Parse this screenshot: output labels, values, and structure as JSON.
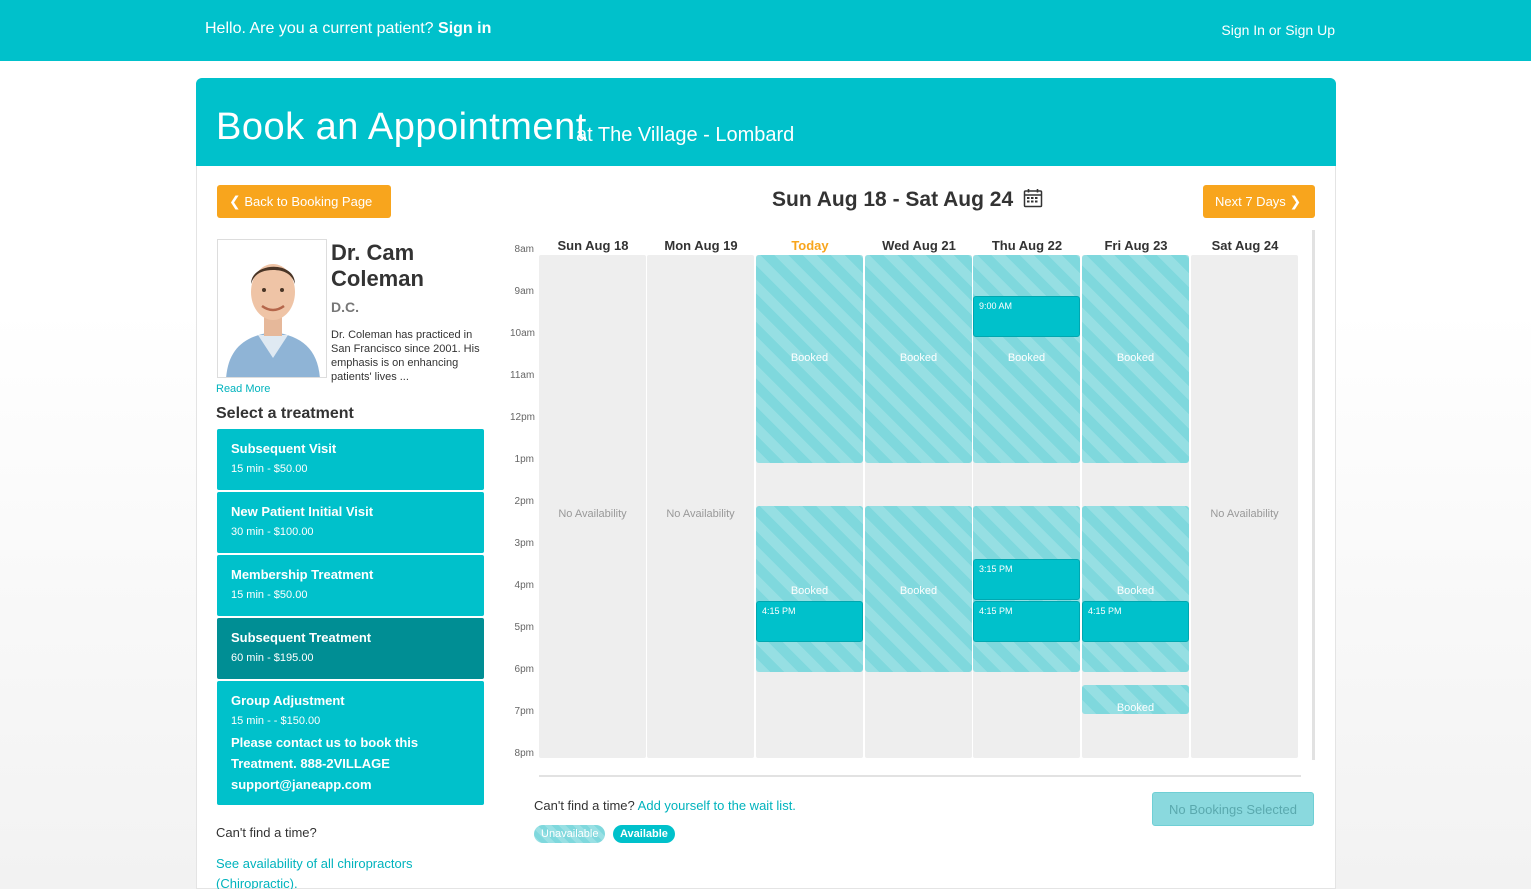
{
  "topbar": {
    "greeting": "Hello. Are you a current patient?",
    "sign_in": "Sign in",
    "sign_in_up": "Sign In or Sign Up"
  },
  "header": {
    "title": "Book an Appointment",
    "location": "at The Village - Lombard"
  },
  "nav": {
    "back_label": "Back to Booking Page",
    "next_label": "Next 7 Days",
    "week_range": "Sun Aug 18 - Sat Aug 24"
  },
  "practitioner": {
    "name": "Dr. Cam Coleman",
    "credential": "D.C.",
    "bio": "Dr. Coleman has practiced in San Francisco since 2001. His emphasis is on enhancing patients' lives ...",
    "read_more": "Read More"
  },
  "treatments_title": "Select a treatment",
  "treatments": [
    {
      "name": "Subsequent Visit",
      "price": "15 min - $50.00"
    },
    {
      "name": "New Patient Initial Visit",
      "price": "30 min - $100.00"
    },
    {
      "name": "Membership Treatment",
      "price": "15 min - $50.00"
    },
    {
      "name": "Subsequent Treatment",
      "price": "60 min - $195.00",
      "selected": true
    },
    {
      "name": "Group Adjustment",
      "price": "15 min - - $150.00",
      "note": "Please contact us to book this Treatment. 888-2VILLAGE support@janeapp.com"
    }
  ],
  "sidebar_footer": {
    "cant_find": "Can't find a time?",
    "see_availability": "See availability of all chiropractors (Chiropractic)."
  },
  "calendar": {
    "times": [
      "8am",
      "9am",
      "10am",
      "11am",
      "12pm",
      "1pm",
      "2pm",
      "3pm",
      "4pm",
      "5pm",
      "6pm",
      "7pm",
      "8pm"
    ],
    "days": [
      {
        "label": "Sun Aug 18",
        "no_availability": "No Availability"
      },
      {
        "label": "Mon Aug 19",
        "no_availability": "No Availability"
      },
      {
        "label": "Today",
        "today": true
      },
      {
        "label": "Wed Aug 21"
      },
      {
        "label": "Thu Aug 22"
      },
      {
        "label": "Fri Aug 23"
      },
      {
        "label": "Sat Aug 24",
        "no_availability": "No Availability"
      }
    ],
    "booked_label": "Booked",
    "slots": {
      "thu_900": "9:00 AM",
      "thu_315": "3:15 PM",
      "tue_415": "4:15 PM",
      "thu_415": "4:15 PM",
      "fri_415": "4:15 PM"
    }
  },
  "footer": {
    "cant_find": "Can't find a time?",
    "wait_list": "Add yourself to the wait list.",
    "legend_unavailable": "Unavailable",
    "legend_available": "Available",
    "no_bookings": "No Bookings Selected"
  },
  "colors": {
    "brand": "#00c1cb",
    "accent": "#f8a51d",
    "selected": "#008e94",
    "booked": "#7fd8dd"
  }
}
